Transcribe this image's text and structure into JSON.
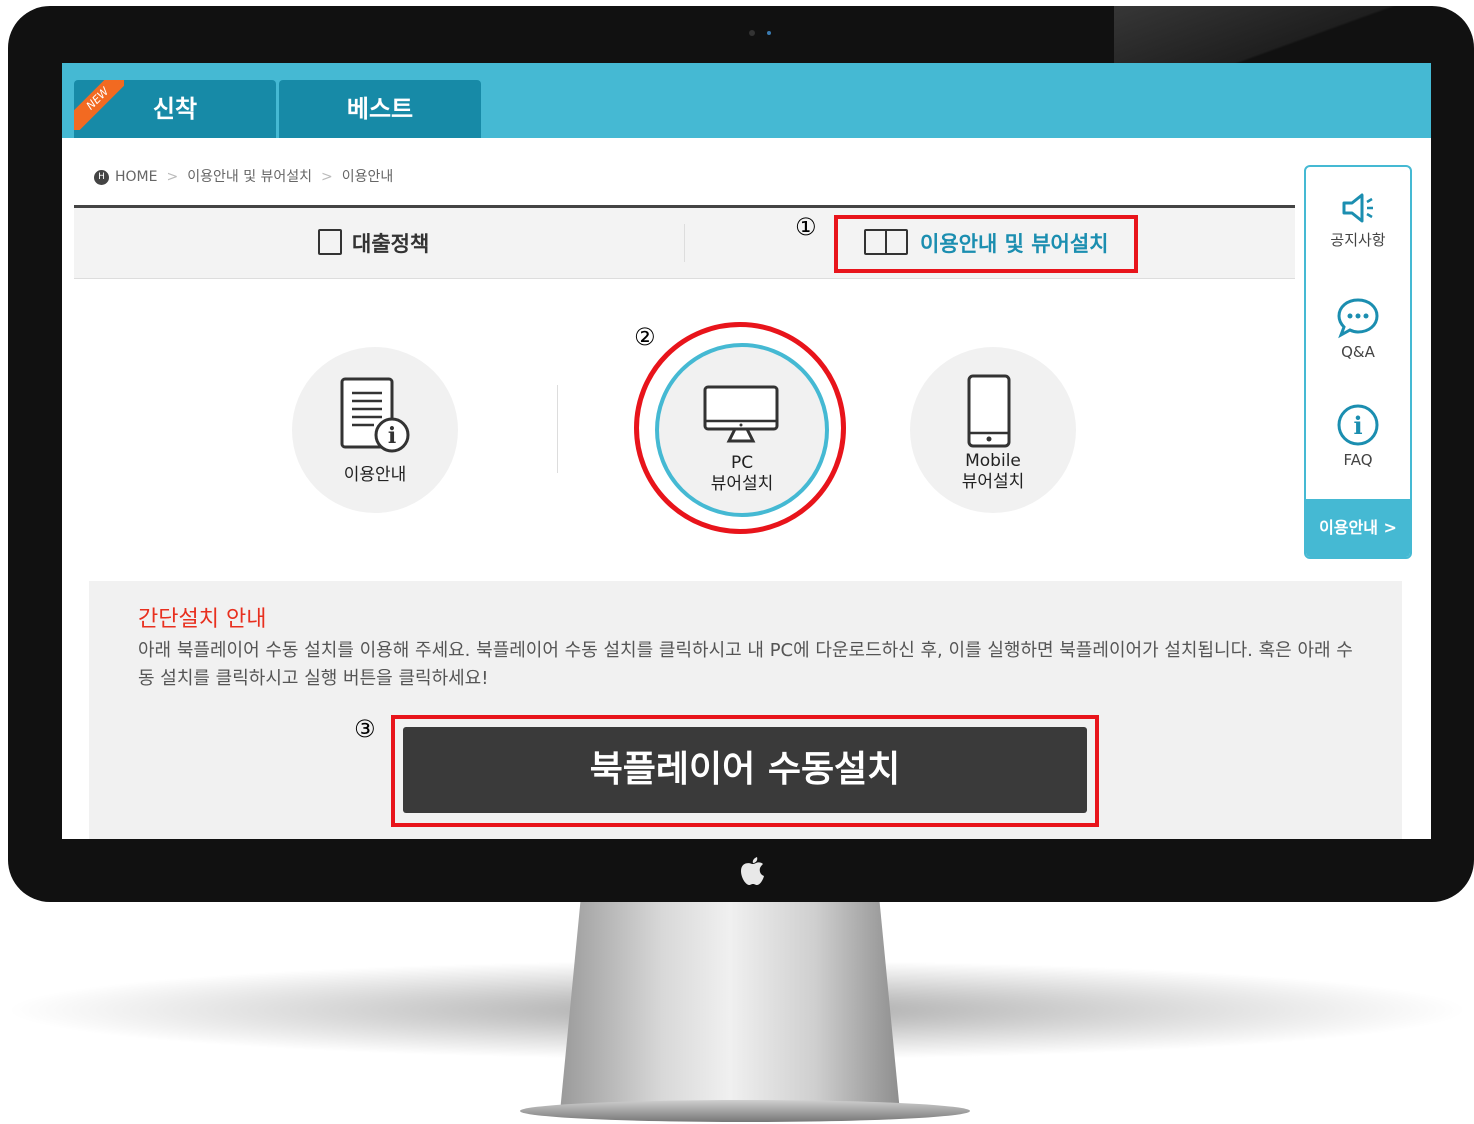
{
  "header": {
    "tabs": [
      {
        "label": "신착",
        "badge": "NEW"
      },
      {
        "label": "베스트"
      }
    ]
  },
  "breadcrumb": {
    "home_icon": "H",
    "items": [
      "HOME",
      "이용안내 및 뷰어설치",
      "이용안내"
    ]
  },
  "section_tabs": {
    "loan_policy": "대출정책",
    "guide_install": "이용안내 및 뷰어설치"
  },
  "annotations": {
    "one": "①",
    "two": "②",
    "three": "③"
  },
  "options": {
    "usage_guide": "이용안내",
    "pc_line1": "PC",
    "pc_line2": "뷰어설치",
    "mobile_line1": "Mobile",
    "mobile_line2": "뷰어설치"
  },
  "side_panel": {
    "notice": "공지사항",
    "qna": "Q&A",
    "faq": "FAQ",
    "guide_button": "이용안내 >"
  },
  "install_guide": {
    "title": "간단설치 안내",
    "text": "아래 북플레이어 수동 설치를 이용해 주세요. 북플레이어 수동 설치를 클릭하시고 내 PC에 다운로드하신 후, 이를 실행하면 북플레이어가 설치됩니다. 혹은 아래 수동 설치를 클릭하시고 실행 버튼을 클릭하세요!",
    "button": "북플레이어 수동설치"
  },
  "colors": {
    "teal": "#45b9d3",
    "tab_dark": "#178aa7",
    "highlight_red": "#e8141b",
    "title_red": "#e8301f"
  }
}
